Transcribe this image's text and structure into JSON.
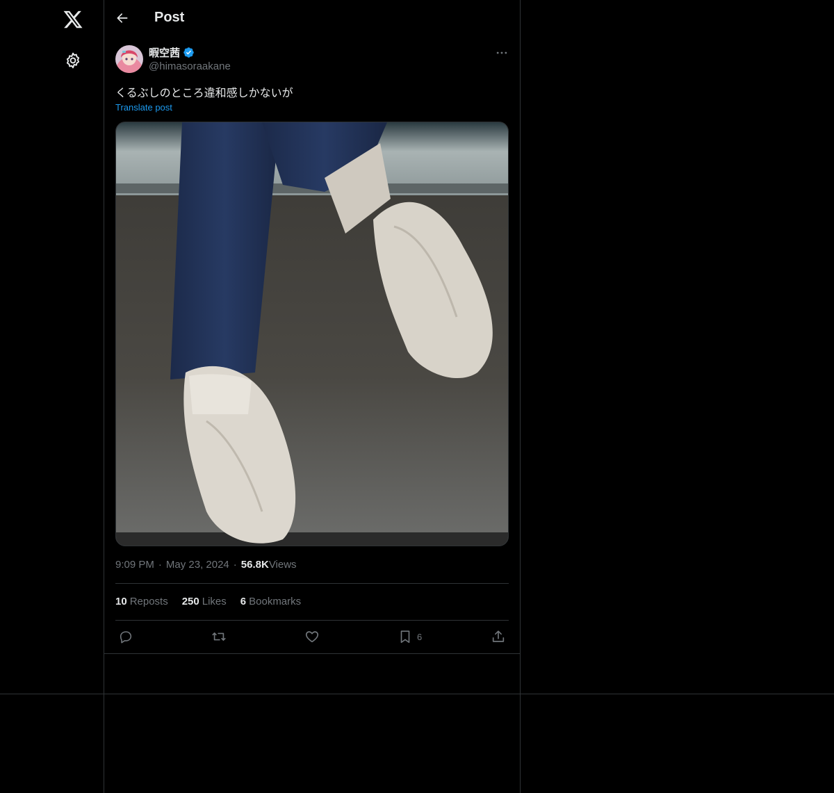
{
  "header": {
    "title": "Post"
  },
  "post": {
    "display_name": "暇空茜",
    "handle": "@himasoraakane",
    "text": "くるぶしのところ違和感しかないが",
    "translate_label": "Translate post",
    "time": "9:09 PM",
    "date": "May 23, 2024",
    "views_count": "56.8K",
    "views_label": "Views",
    "reposts_count": "10",
    "reposts_label": "Reposts",
    "likes_count": "250",
    "likes_label": "Likes",
    "bookmarks_count": "6",
    "bookmarks_label": "Bookmarks",
    "bookmark_action_count": "6",
    "dot": "·"
  },
  "icons": {
    "logo": "x-logo-icon",
    "settings": "gear-icon",
    "back": "back-arrow-icon",
    "verified": "verified-badge-icon",
    "more": "more-icon",
    "reply": "reply-icon",
    "repost": "repost-icon",
    "like": "heart-icon",
    "bookmark": "bookmark-icon",
    "share": "share-icon"
  },
  "colors": {
    "background": "#000000",
    "text": "#e7e9ea",
    "secondary": "#71767b",
    "accent": "#1d9bf0",
    "border": "#2f3336"
  }
}
